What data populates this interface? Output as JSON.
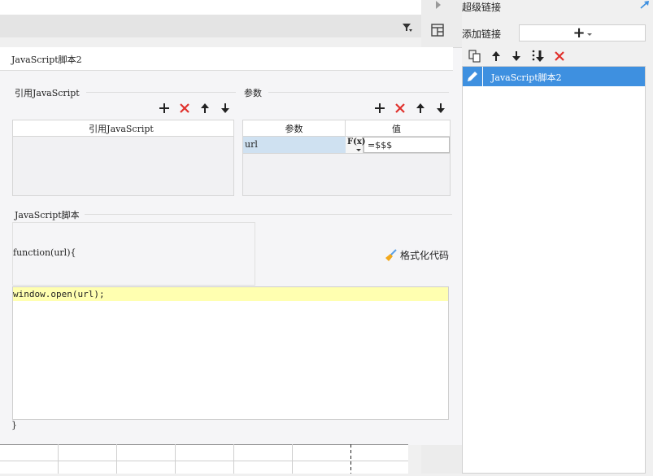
{
  "icons": {
    "play": "play-triangle-icon",
    "filter": "filter-icon",
    "layout": "layout-icon",
    "expand": "expand-arrow-icon"
  },
  "colors": {
    "accent": "#3e90e0",
    "delete": "#e0302c",
    "highlight": "#ffffb0",
    "param_cell": "#cfe1f1"
  },
  "dialog": {
    "title": "JavaScript脚本2",
    "imports": {
      "section_title": "引用JavaScript",
      "column_header": "引用JavaScript"
    },
    "params": {
      "section_title": "参数",
      "headers": [
        "参数",
        "值"
      ],
      "rows": [
        {
          "name": "url",
          "fx": "F(x)",
          "value": "=$$$"
        }
      ]
    },
    "script": {
      "section_title": "JavaScript脚本",
      "signature": "function(url){",
      "format_label": "格式化代码",
      "body_line": "window.open(url);",
      "closing": "}"
    }
  },
  "right_panel": {
    "title": "超级链接",
    "add_label": "添加链接",
    "add_button": "+",
    "items": [
      "JavaScript脚本2"
    ]
  }
}
